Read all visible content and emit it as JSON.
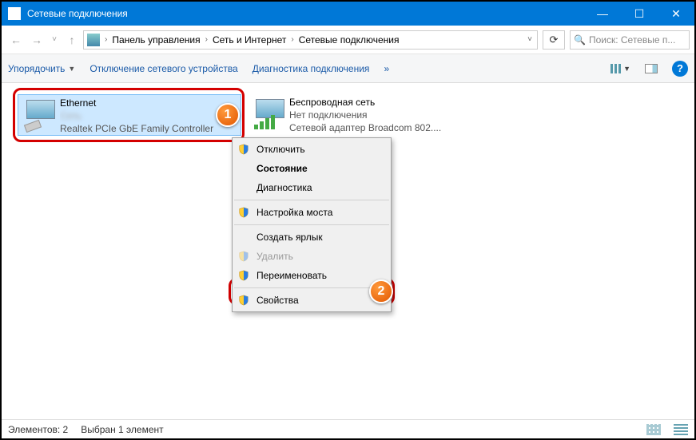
{
  "window": {
    "title": "Сетевые подключения"
  },
  "breadcrumb": {
    "root_chev": "›",
    "items": [
      "Панель управления",
      "Сеть и Интернет",
      "Сетевые подключения"
    ]
  },
  "search": {
    "placeholder": "Поиск: Сетевые п..."
  },
  "cmdbar": {
    "organize": "Упорядочить",
    "disable": "Отключение сетевого устройства",
    "diag": "Диагностика подключения",
    "more": "»"
  },
  "connections": {
    "ethernet": {
      "name": "Ethernet",
      "status": "Сеть",
      "device": "Realtek PCIe GbE Family Controller"
    },
    "wifi": {
      "name": "Беспроводная сеть",
      "status": "Нет подключения",
      "device": "Сетевой адаптер Broadcom 802...."
    }
  },
  "context_menu": {
    "disable": "Отключить",
    "status": "Состояние",
    "diag": "Диагностика",
    "bridge": "Настройка моста",
    "shortcut": "Создать ярлык",
    "delete": "Удалить",
    "rename": "Переименовать",
    "properties": "Свойства"
  },
  "statusbar": {
    "count": "Элементов: 2",
    "selected": "Выбран 1 элемент"
  },
  "badges": {
    "one": "1",
    "two": "2"
  }
}
